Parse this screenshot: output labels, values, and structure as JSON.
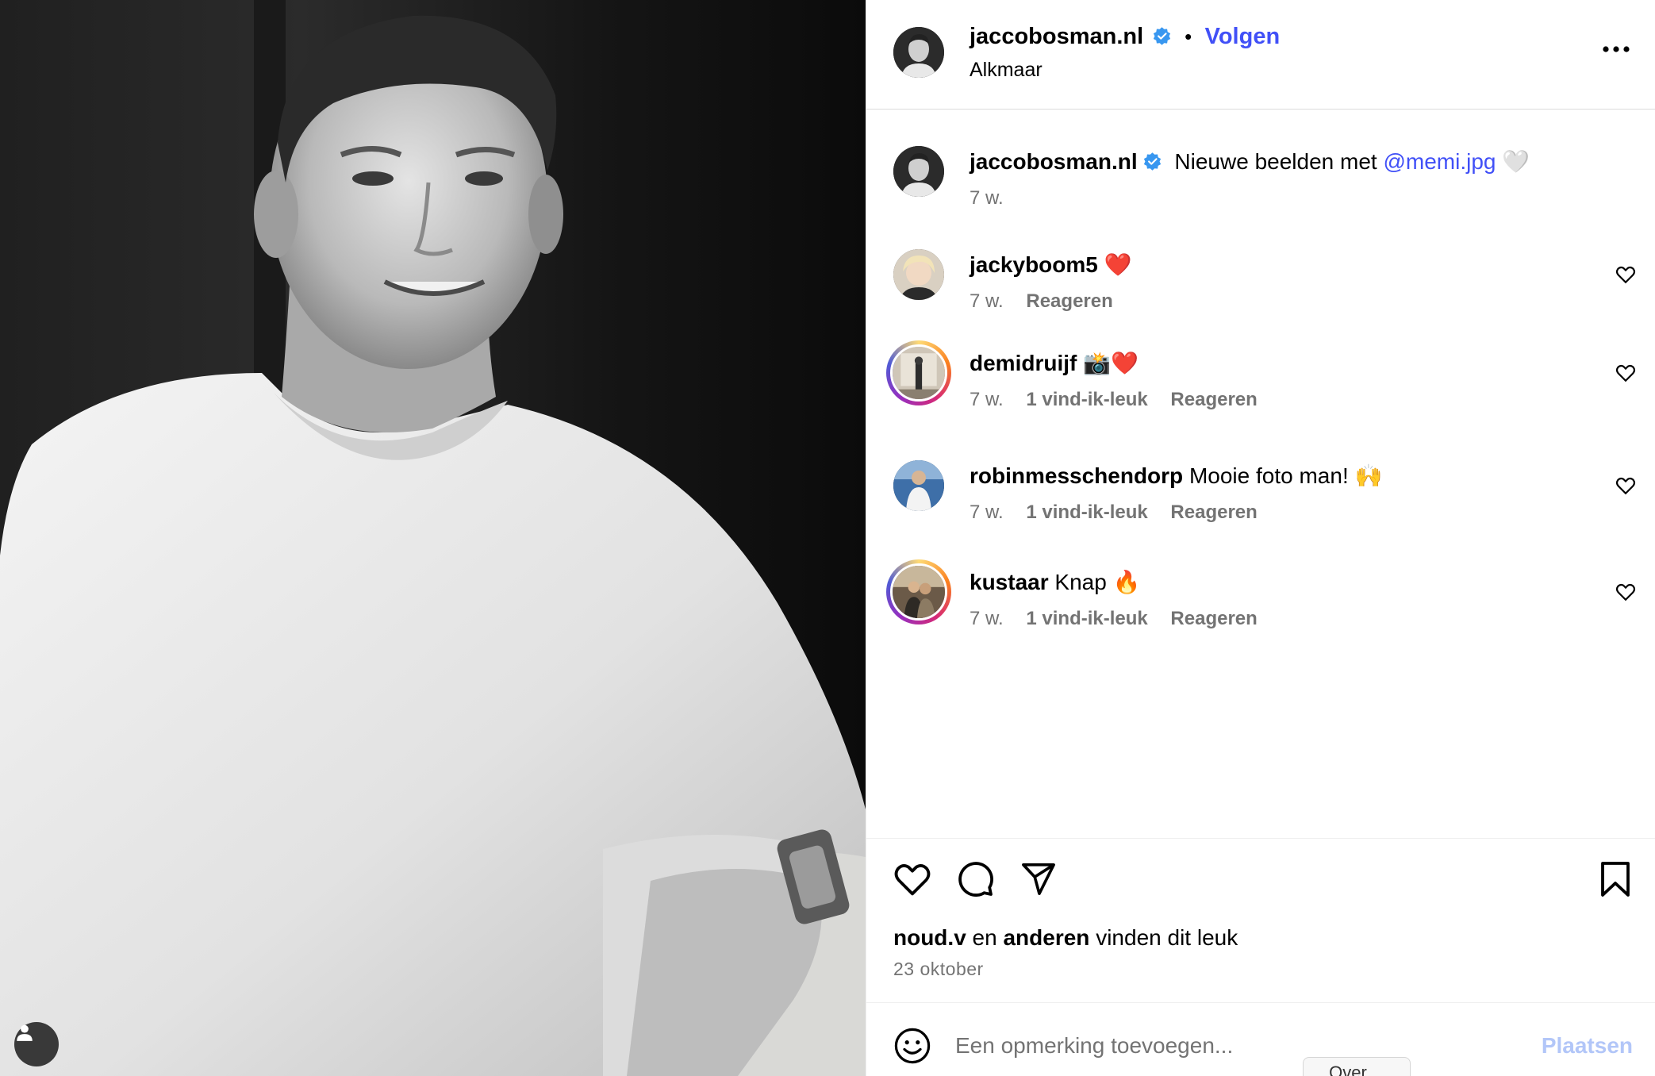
{
  "post": {
    "author": "jaccobosman.nl",
    "follow_label": "Volgen",
    "location": "Alkmaar",
    "caption_text": "Nieuwe beelden met ",
    "caption_mention": "@memi.jpg",
    "caption_emoji": "🤍",
    "caption_age": "7 w."
  },
  "comments": [
    {
      "user": "jackyboom5",
      "text": "❤️",
      "age": "7 w.",
      "likes": "",
      "reply": "Reageren"
    },
    {
      "user": "demidruijf",
      "text": "📸❤️",
      "age": "7 w.",
      "likes": "1 vind-ik-leuk",
      "reply": "Reageren"
    },
    {
      "user": "robinmesschendorp",
      "text": "Mooie foto man! 🙌",
      "age": "7 w.",
      "likes": "1 vind-ik-leuk",
      "reply": "Reageren"
    },
    {
      "user": "kustaar",
      "text": "Knap 🔥",
      "age": "7 w.",
      "likes": "1 vind-ik-leuk",
      "reply": "Reageren"
    }
  ],
  "likes_summary": {
    "first_user": "noud.v",
    "connector": "en",
    "others": "anderen",
    "suffix": "vinden dit leuk"
  },
  "date": "23 oktober",
  "composer": {
    "placeholder": "Een opmerking toevoegen...",
    "post_label": "Plaatsen"
  },
  "tooltip_fragment": "Over…",
  "colors": {
    "link_blue": "#4150f7",
    "verified_blue": "#3897f0",
    "muted_gray": "#737373",
    "post_button_disabled": "#b2c6f8"
  },
  "icons": [
    "verified-badge-icon",
    "more-options-icon",
    "like-icon",
    "comment-icon",
    "share-icon",
    "bookmark-icon",
    "emoji-icon",
    "user-tag-icon"
  ]
}
